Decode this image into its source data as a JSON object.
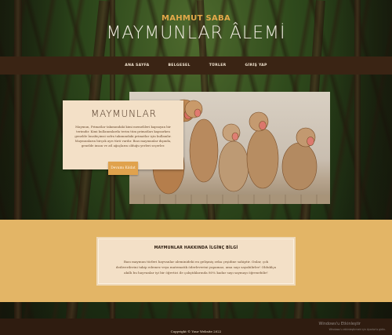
{
  "header": {
    "site_name": "MAHMUT SABA",
    "title": "MAYMUNLAR ÂLEMİ"
  },
  "nav": {
    "items": [
      {
        "label": "ANA SAYFA"
      },
      {
        "label": "BELGESEL"
      },
      {
        "label": "TÜRLER"
      },
      {
        "label": "GİRİŞ YAP"
      }
    ]
  },
  "hero": {
    "image_alt_icon": "monkeys-photo",
    "card_title": "MAYMUNLAR",
    "card_text": "Maymun, Primatlar takımındaki kimi memelileri kapsayan bir terimdir. Kimi kullanımlarda terim tüm primatları kapsarken genelde İnsabiçimsi sofra takımındaki primatlar için kullanılır. Maymunların birçok ayrı türü vardır. Bazı maymunlar dışında, genelde insan ve atl ağaçların olduğu yerleri seçerler.",
    "button_label": "Devamı Kıldat"
  },
  "info": {
    "title": "MAYMUNLAR HAKKINDA İLGİNÇ BİLGİ",
    "text": "Bazı maymun türleri hayvanlar aleminideki en gelişmiş zeka çeşidine sahiptir. Onlar, çok dediverilerini takip edemez veya matematik öderleverini yapamaz, ama sayı sayabilirler! Olduklça akıllı bu hayvanlar iyi bir öğretici ile çalıştıklarında 80% kadar sayı saymayı öğrenebilir!"
  },
  "footer": {
    "copyright": "Copyright © Your Website 2022"
  },
  "os_watermark": {
    "title": "Windows'u Etkinleştir",
    "subtitle": "Windows'u etkinleştirmek için Ayarlar'a gidin."
  },
  "colors": {
    "accent": "#e3b566",
    "nav_bg": "#3a2414",
    "card_bg": "#f3e0c7",
    "button": "#e0a24d"
  }
}
